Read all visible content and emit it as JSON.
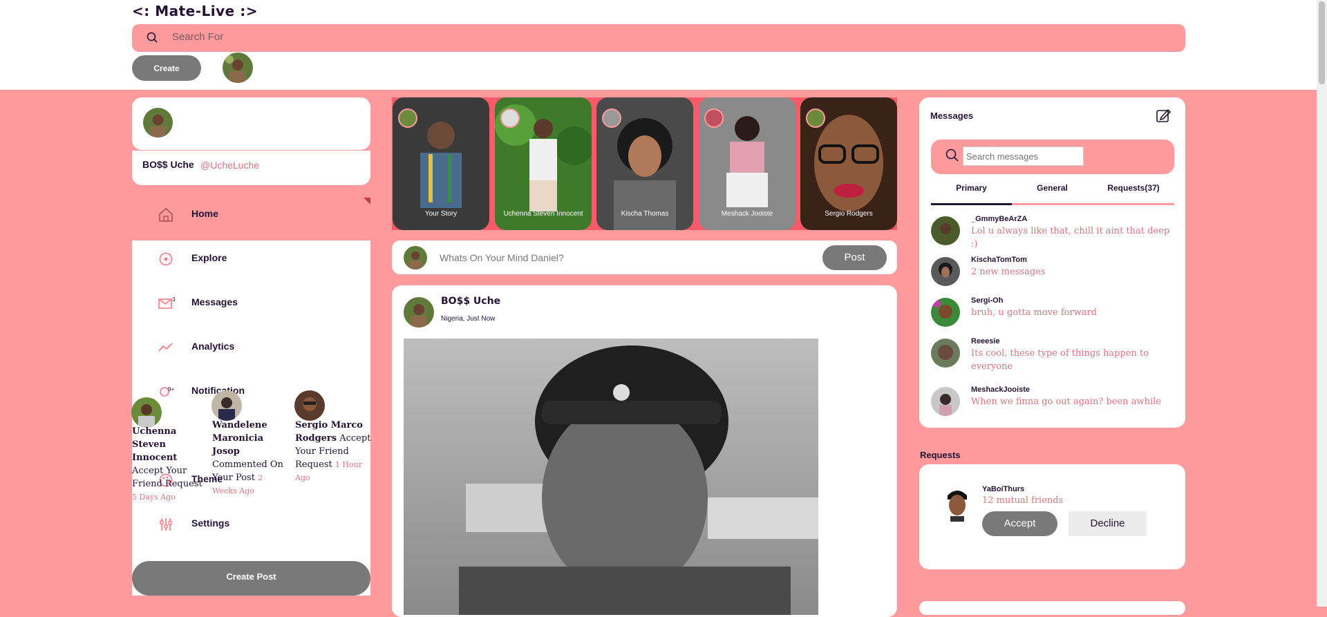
{
  "header": {
    "logo": "<: Mate-Live :>",
    "search_placeholder": "Search For",
    "create_label": "Create"
  },
  "profile": {
    "name": "BO$$ Uche",
    "handle": "@UcheLuche"
  },
  "sidebar": {
    "items": [
      {
        "label": "Home",
        "icon": "home-icon"
      },
      {
        "label": "Explore",
        "icon": "explore-icon"
      },
      {
        "label": "Messages",
        "icon": "mail-icon",
        "badge": "3"
      },
      {
        "label": "Analytics",
        "icon": "analytics-icon"
      },
      {
        "label": "Notification",
        "icon": "bell-icon",
        "badge": "9+"
      },
      {
        "label": "Theme",
        "icon": "palette-icon"
      },
      {
        "label": "Settings",
        "icon": "settings-icon"
      }
    ],
    "create_post_label": "Create Post"
  },
  "notifications": [
    {
      "who": "Uchenna Steven Innocent",
      "action": " Accept Your Friend Request ",
      "time": "5 Days Ago"
    },
    {
      "who": "Wandelene Maronicia Josop",
      "action": " Commented On Your Post ",
      "time": "2 Weeks Ago"
    },
    {
      "who": "Sergio Marco Rodgers",
      "action": " Accept Your Friend Request ",
      "time": "1 Hour Ago"
    }
  ],
  "stories": [
    {
      "caption": "Your Story"
    },
    {
      "caption": "Uchenna Steven Innocent"
    },
    {
      "caption": "Kischa Thomas"
    },
    {
      "caption": "Meshack Jooiste"
    },
    {
      "caption": "Sergio Rodgers"
    }
  ],
  "composer": {
    "placeholder": "Whats On Your Mind Daniel?",
    "post_label": "Post"
  },
  "post": {
    "author": "BO$$ Uche",
    "meta": "Nigeria, Just Now"
  },
  "messages": {
    "title": "Messages",
    "search_placeholder": "Search messages",
    "tabs": [
      "Primary",
      "General",
      "Requests(37)"
    ],
    "items": [
      {
        "name": "_GmmyBeArZA",
        "text": "Lol u always like that, chill it aint that deep :)"
      },
      {
        "name": "KischaTomTom",
        "text": "2 new messages"
      },
      {
        "name": "Sergi-Oh",
        "text": "bruh, u gotta move forward"
      },
      {
        "name": "Reeesie",
        "text": "Its cool, these type of things happen to everyone"
      },
      {
        "name": "MeshackJooiste",
        "text": "When we finna go out again? been awhile"
      }
    ]
  },
  "requests": {
    "title": "Requests",
    "name": "YaBoiThurs",
    "mutual": "12 mutual friends",
    "accept_label": "Accept",
    "decline_label": "Decline"
  },
  "colors": {
    "accent": "#ff9b9d",
    "dark": "#231233",
    "button": "#797979",
    "muted_text": "#d0787f"
  }
}
